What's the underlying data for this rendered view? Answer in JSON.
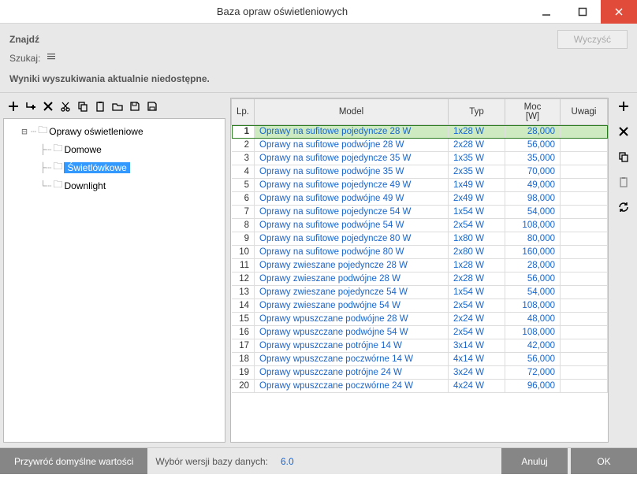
{
  "window": {
    "title": "Baza opraw oświetleniowych"
  },
  "search": {
    "findLabel": "Znajdź",
    "searchLabel": "Szukaj:",
    "clearLabel": "Wyczyść",
    "resultsMsg": "Wyniki wyszukiwania aktualnie niedostępne."
  },
  "tree": {
    "root": "Oprawy oświetleniowe",
    "children": [
      {
        "label": "Domowe",
        "selected": false
      },
      {
        "label": "Świetlówkowe",
        "selected": true
      },
      {
        "label": "Downlight",
        "selected": false
      }
    ]
  },
  "columns": {
    "lp": "Lp.",
    "model": "Model",
    "typ": "Typ",
    "moc": "Moc\n[W]",
    "uwagi": "Uwagi"
  },
  "rows": [
    {
      "lp": 1,
      "model": "Oprawy na sufitowe pojedyncze 28 W",
      "typ": "1x28 W",
      "moc": "28,000",
      "sel": true
    },
    {
      "lp": 2,
      "model": "Oprawy na sufitowe podwójne 28 W",
      "typ": "2x28 W",
      "moc": "56,000"
    },
    {
      "lp": 3,
      "model": "Oprawy na sufitowe pojedyncze 35 W",
      "typ": "1x35 W",
      "moc": "35,000"
    },
    {
      "lp": 4,
      "model": "Oprawy na sufitowe podwójne 35 W",
      "typ": "2x35 W",
      "moc": "70,000"
    },
    {
      "lp": 5,
      "model": "Oprawy na sufitowe pojedyncze 49 W",
      "typ": "1x49 W",
      "moc": "49,000"
    },
    {
      "lp": 6,
      "model": "Oprawy na sufitowe podwójne 49 W",
      "typ": "2x49 W",
      "moc": "98,000"
    },
    {
      "lp": 7,
      "model": "Oprawy na sufitowe pojedyncze 54 W",
      "typ": "1x54 W",
      "moc": "54,000"
    },
    {
      "lp": 8,
      "model": "Oprawy na sufitowe podwójne 54 W",
      "typ": "2x54 W",
      "moc": "108,000"
    },
    {
      "lp": 9,
      "model": "Oprawy na sufitowe pojedyncze 80 W",
      "typ": "1x80 W",
      "moc": "80,000"
    },
    {
      "lp": 10,
      "model": "Oprawy na sufitowe podwójne 80 W",
      "typ": "2x80 W",
      "moc": "160,000"
    },
    {
      "lp": 11,
      "model": "Oprawy zwieszane pojedyncze 28 W",
      "typ": "1x28 W",
      "moc": "28,000"
    },
    {
      "lp": 12,
      "model": "Oprawy zwieszane podwójne 28 W",
      "typ": "2x28 W",
      "moc": "56,000"
    },
    {
      "lp": 13,
      "model": "Oprawy zwieszane pojedyncze 54 W",
      "typ": "1x54 W",
      "moc": "54,000"
    },
    {
      "lp": 14,
      "model": "Oprawy zwieszane podwójne 54 W",
      "typ": "2x54 W",
      "moc": "108,000"
    },
    {
      "lp": 15,
      "model": "Oprawy wpuszczane podwójne 28 W",
      "typ": "2x24 W",
      "moc": "48,000"
    },
    {
      "lp": 16,
      "model": "Oprawy wpuszczane podwójne 54 W",
      "typ": "2x54 W",
      "moc": "108,000"
    },
    {
      "lp": 17,
      "model": "Oprawy wpuszczane potrójne 14 W",
      "typ": "3x14 W",
      "moc": "42,000"
    },
    {
      "lp": 18,
      "model": "Oprawy wpuszczane poczwórne 14 W",
      "typ": "4x14 W",
      "moc": "56,000"
    },
    {
      "lp": 19,
      "model": "Oprawy wpuszczane potrójne 24 W",
      "typ": "3x24 W",
      "moc": "72,000"
    },
    {
      "lp": 20,
      "model": "Oprawy wpuszczane poczwórne 24 W",
      "typ": "4x24 W",
      "moc": "96,000"
    }
  ],
  "footer": {
    "restore": "Przywróć domyślne wartości",
    "dbLabel": "Wybór wersji bazy danych:",
    "dbVersion": "6.0",
    "cancel": "Anuluj",
    "ok": "OK"
  }
}
